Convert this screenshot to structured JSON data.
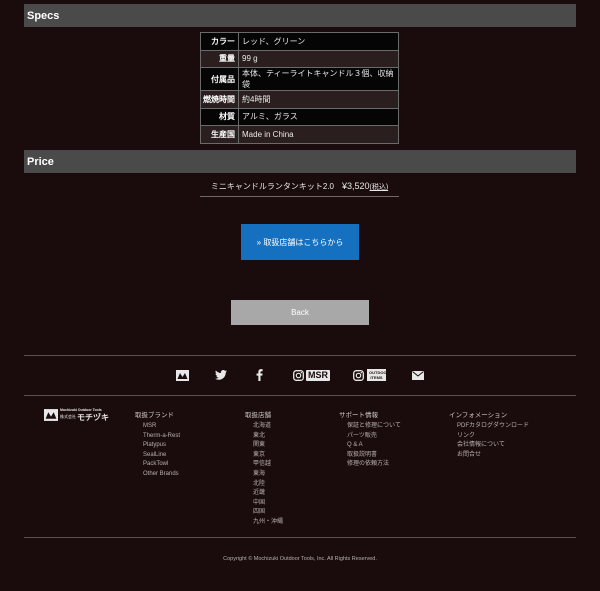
{
  "specs": {
    "title": "Specs",
    "rows": [
      {
        "key": "カラー",
        "value": "レッド、グリーン"
      },
      {
        "key": "重量",
        "value": "99 g"
      },
      {
        "key": "付属品",
        "value": "本体、ティーライトキャンドル３個、収納袋"
      },
      {
        "key": "燃焼時間",
        "value": "約4時間"
      },
      {
        "key": "材質",
        "value": "アルミ、ガラス"
      },
      {
        "key": "生産国",
        "value": "Made in China"
      }
    ]
  },
  "price": {
    "title": "Price",
    "product": "ミニキャンドルランタンキット2.0",
    "amount": "¥3,520",
    "tax": "(税込)"
  },
  "buttons": {
    "store": "» 取扱店舗はこちらから",
    "back": "Back"
  },
  "social": {
    "icons": [
      "brand-logo-icon",
      "twitter-icon",
      "facebook-icon",
      "instagram-msr-icon",
      "instagram-outdoor-icon",
      "mail-icon"
    ],
    "msr_label": "MSR",
    "outdoor_label_1": "OUTDOOR",
    "outdoor_label_2": "ITEMS"
  },
  "logo": {
    "line1": "Mochizuki Outdoor Tools",
    "line2a": "株式会社",
    "line2b": "モチヅキ"
  },
  "footer": {
    "brands": {
      "title": "取扱ブランド",
      "items": [
        "MSR",
        "Therm-a-Rest",
        "Platypus",
        "SealLine",
        "PackTowl",
        "Other Brands"
      ]
    },
    "stores": {
      "title": "取扱店舗",
      "items": [
        "北海道",
        "東北",
        "関東",
        "東京",
        "甲信越",
        "東海",
        "北陸",
        "近畿",
        "中国",
        "四国",
        "九州・沖縄"
      ]
    },
    "support": {
      "title": "サポート情報",
      "items": [
        "保証と修理について",
        "パーツ販売",
        "Q & A",
        "取扱説明書",
        "修理の依頼方法"
      ]
    },
    "info": {
      "title": "インフォメーション",
      "items": [
        "PDFカタログダウンロード",
        "リンク",
        "会社情報について",
        "お問合せ"
      ]
    },
    "copyright": "Copyright © Mochizuki Outdoor Tools, Inc. All Rights Reserved."
  }
}
